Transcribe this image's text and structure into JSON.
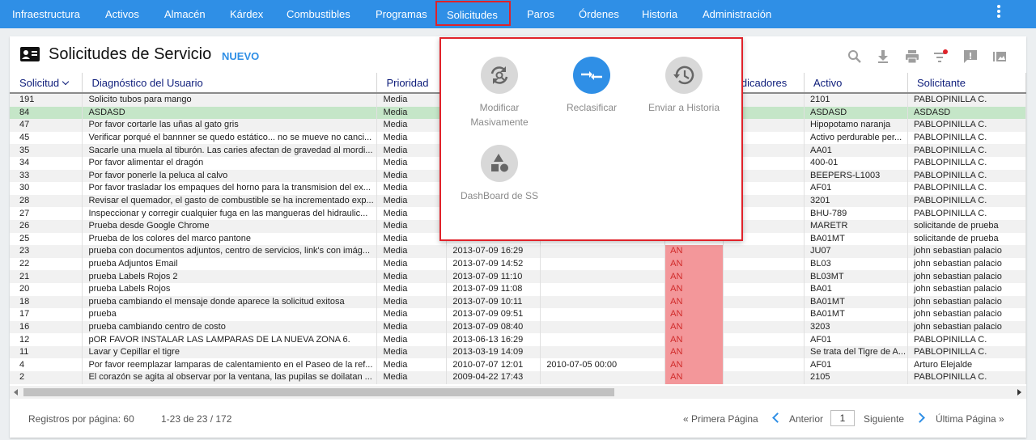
{
  "nav": {
    "items": [
      "Infraestructura",
      "Activos",
      "Almacén",
      "Kárdex",
      "Combustibles",
      "Programas",
      "Solicitudes",
      "Paros",
      "Órdenes",
      "Historia",
      "Administración"
    ]
  },
  "page": {
    "title": "Solicitudes de Servicio",
    "new_label": "NUEVO"
  },
  "table": {
    "columns": [
      "Solicitud",
      "Diagnóstico del Usuario",
      "Prioridad",
      "",
      "",
      "",
      "Indicadores",
      "Activo",
      "Solicitante"
    ],
    "sort_column": "Solicitud",
    "rows": [
      [
        "191",
        "Solicito tubos para mango",
        "Media",
        "",
        "",
        "",
        "",
        "2101",
        "PABLOPINILLA C."
      ],
      [
        "84",
        "ASDASD",
        "Media",
        "",
        "",
        "",
        "",
        "ASDASD",
        "ASDASD"
      ],
      [
        "47",
        "Por favor cortarle las uñas al gato gris",
        "Media",
        "",
        "",
        "",
        "",
        "Hipopotamo naranja",
        "PABLOPINILLA C."
      ],
      [
        "45",
        "Verificar porqué el bannner se quedo estático... no se mueve no canci...",
        "Media",
        "",
        "",
        "",
        "",
        "Activo perdurable per...",
        "PABLOPINILLA C."
      ],
      [
        "35",
        "Sacarle una muela al tiburón. Las caries afectan de gravedad al mordi...",
        "Media",
        "",
        "",
        "",
        "",
        "AA01",
        "PABLOPINILLA C."
      ],
      [
        "34",
        "Por favor alimentar el dragón",
        "Media",
        "",
        "",
        "",
        "",
        "400-01",
        "PABLOPINILLA C."
      ],
      [
        "33",
        "Por favor ponerle la peluca al calvo",
        "Media",
        "",
        "",
        "",
        "",
        "BEEPERS-L1003",
        "PABLOPINILLA C."
      ],
      [
        "30",
        "Por favor trasladar los empaques del horno para la transmision del ex...",
        "Media",
        "",
        "",
        "",
        "",
        "AF01",
        "PABLOPINILLA C."
      ],
      [
        "28",
        "Revisar el quemador, el gasto de combustible se ha incrementado exp...",
        "Media",
        "",
        "",
        "",
        "",
        "3201",
        "PABLOPINILLA C."
      ],
      [
        "27",
        "Inspeccionar y corregir cualquier fuga en las mangueras del hidraulic...",
        "Media",
        "",
        "",
        "",
        "",
        "BHU-789",
        "PABLOPINILLA C."
      ],
      [
        "26",
        "Prueba desde Google Chrome",
        "Media",
        "",
        "",
        "",
        "",
        "MARETR",
        "solicitande de prueba"
      ],
      [
        "25",
        "Prueba de los colores del marco pantone",
        "Media",
        "",
        "",
        "",
        "",
        "BA01MT",
        "solicitande de prueba"
      ],
      [
        "23",
        "prueba con documentos adjuntos, centro de servicios, link's con imág...",
        "Media",
        "2013-07-09 16:29",
        "",
        "AN",
        "",
        "JU07",
        "john sebastian palacio"
      ],
      [
        "22",
        "prueba Adjuntos Email",
        "Media",
        "2013-07-09 14:52",
        "",
        "AN",
        "",
        "BL03",
        "john sebastian palacio"
      ],
      [
        "21",
        "prueba Labels Rojos 2",
        "Media",
        "2013-07-09 11:10",
        "",
        "AN",
        "",
        "BL03MT",
        "john sebastian palacio"
      ],
      [
        "20",
        "prueba Labels Rojos",
        "Media",
        "2013-07-09 11:08",
        "",
        "AN",
        "",
        "BA01",
        "john sebastian palacio"
      ],
      [
        "18",
        "prueba cambiando el mensaje donde aparece la solicitud exitosa",
        "Media",
        "2013-07-09 10:11",
        "",
        "AN",
        "",
        "BA01MT",
        "john sebastian palacio"
      ],
      [
        "17",
        "prueba",
        "Media",
        "2013-07-09 09:51",
        "",
        "AN",
        "",
        "BA01MT",
        "john sebastian palacio"
      ],
      [
        "16",
        "prueba cambiando centro de costo",
        "Media",
        "2013-07-09 08:40",
        "",
        "AN",
        "",
        "3203",
        "john sebastian palacio"
      ],
      [
        "12",
        "pOR FAVOR INSTALAR LAS LAMPARAS DE LA NUEVA ZONA 6.",
        "Media",
        "2013-06-13 16:29",
        "",
        "AN",
        "",
        "AF01",
        "PABLOPINILLA C."
      ],
      [
        "11",
        "Lavar y Cepillar el tigre",
        "Media",
        "2013-03-19 14:09",
        "",
        "AN",
        "",
        "Se trata del Tigre de A...",
        "PABLOPINILLA C."
      ],
      [
        "4",
        "Por favor reemplazar lamparas de calentamiento en el Paseo de la ref...",
        "Media",
        "2010-07-07 12:01",
        "2010-07-05 00:00",
        "AN",
        "",
        "AF01",
        "Arturo Elejalde"
      ],
      [
        "2",
        "El corazón se agita al observar por la ventana, las pupilas se doilatan ...",
        "Media",
        "2009-04-22 17:43",
        "",
        "AN",
        "",
        "2105",
        "PABLOPINILLA C."
      ]
    ],
    "selected_row": 1
  },
  "footer": {
    "records_per_page": "Registros por página: 60",
    "range": "1-23 de 23 / 172",
    "first": "« Primera Página",
    "prev": "Anterior",
    "page": "1",
    "next": "Siguiente",
    "last": "Última Página »"
  },
  "dropdown": {
    "items": [
      {
        "label": "Modificar Masivamente",
        "icon": "refresh-search-icon"
      },
      {
        "label": "Reclasificar",
        "icon": "swap-arrows-icon"
      },
      {
        "label": "Enviar a Historia",
        "icon": "history-icon"
      },
      {
        "label": "DashBoard de SS",
        "icon": "shapes-icon"
      }
    ]
  },
  "colors": {
    "nav": "#2f8fe6",
    "accent": "#2f8fe6",
    "highlight": "#e0222a",
    "selected_row": "#c5e6c8",
    "indicator": "#f3979a"
  }
}
